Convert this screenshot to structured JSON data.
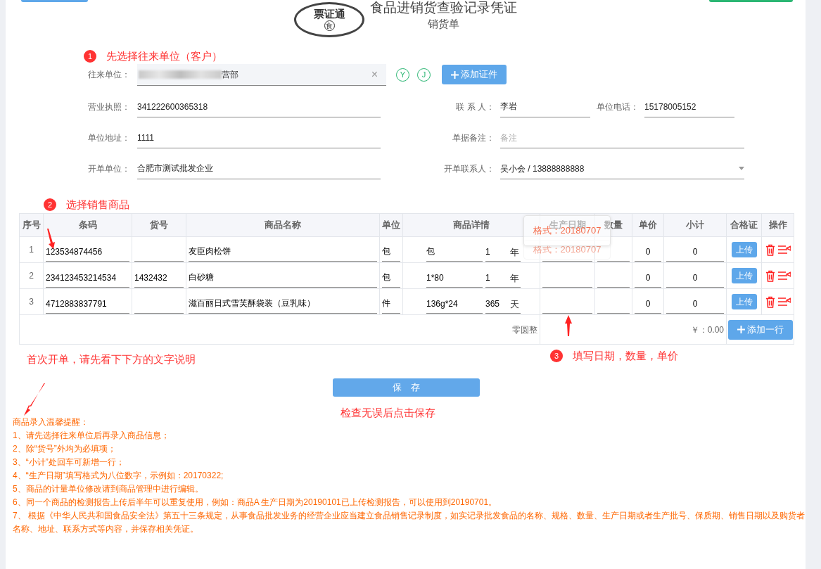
{
  "header": {
    "logo_text": "票证通",
    "logo_badge": "食",
    "title": "食品进销货查验记录凭证",
    "subtitle": "销货单"
  },
  "steps": [
    {
      "number": "1",
      "text": "先选择往来单位（客户）"
    },
    {
      "number": "2",
      "text": "选择销售商品"
    },
    {
      "number": "3",
      "text": "填写日期，数量，单价"
    }
  ],
  "partner": {
    "label": "往来单位：",
    "value": "营部",
    "blurred": true,
    "clear": "×",
    "quick_tags": [
      "Y",
      "J"
    ],
    "add_button": "添加证件"
  },
  "field_rows": [
    {
      "left": {
        "label": "营业执照：",
        "value": "341222600365318",
        "kind": "text"
      },
      "right": [
        {
          "label": "联 系 人：",
          "value": "李岩",
          "kind": "text"
        },
        {
          "label": "单位电话：",
          "value": "15178005152",
          "kind": "text"
        }
      ]
    },
    {
      "left": {
        "label": "单位地址：",
        "value": "1111",
        "kind": "text"
      },
      "right": [
        {
          "label": "单据备注：",
          "placeholder": "备注",
          "kind": "text"
        }
      ]
    },
    {
      "left": {
        "label": "开单单位：",
        "value": "合肥市测试批发企业",
        "kind": "text"
      },
      "right": [
        {
          "label": "开单联系人：",
          "value": "吴小会  /  13888888888",
          "kind": "select"
        }
      ]
    }
  ],
  "table": {
    "columns": [
      "序号",
      "条码",
      "货号",
      "商品名称",
      "单位",
      "商品详情",
      "生产日期",
      "数量",
      "单价",
      "小计",
      "合格证",
      "操作"
    ],
    "rows": [
      {
        "index": "1",
        "barcode": "123534874456",
        "item_no": "",
        "name": "友臣肉松饼",
        "unit": "包",
        "spec": "包",
        "shelf_life": "1",
        "shelf_unit": "年",
        "production_date": "",
        "quantity": "",
        "price": "0",
        "subtotal": "0",
        "upload": "上传"
      },
      {
        "index": "2",
        "barcode": "234123453214534",
        "item_no": "1432432",
        "name": "白砂糖",
        "unit": "包",
        "spec": "1*80",
        "shelf_life": "1",
        "shelf_unit": "年",
        "production_date": "",
        "quantity": "",
        "price": "0",
        "subtotal": "0",
        "upload": "上传"
      },
      {
        "index": "3",
        "barcode": "4712883837791",
        "item_no": "",
        "name": "滋百丽日式雪芙酥袋装（豆乳味）",
        "unit": "件",
        "spec": "136g*24",
        "shelf_life": "365",
        "shelf_unit": "天",
        "production_date": "",
        "quantity": "",
        "price": "0",
        "subtotal": "0",
        "upload": "上传"
      }
    ],
    "footer": {
      "rounding": "零圆整",
      "total": "￥：0.00",
      "add_row": "添加一行"
    }
  },
  "tooltips": [
    {
      "text": "格式：20180707",
      "faded": false
    },
    {
      "text": "格式：20180707",
      "faded": true
    }
  ],
  "first_time_hint": "首次开单，请先看下下方的文字说明",
  "save_button": "保　存",
  "save_hint": "检查无误后点击保存",
  "notes": {
    "title": "商品录入温馨提醒：",
    "items": [
      "1、请先选择往来单位后再录入商品信息；",
      "2、除“货号”外均为必填项；",
      "3、“小计”处回车可新增一行；",
      "4、“生产日期”填写格式为八位数字，示例如：20170322;",
      "5、商品的计量单位修改请到商品管理中进行编辑。",
      "6、同一个商品的检测报告上传后半年可以重复使用，例如：商品A 生产日期为20190101已上传检测报告，可以使用到20190701。",
      "7、 根据《中华人民共和国食品安全法》第五十三条规定，从事食品批发业务的经营企业应当建立食品销售记录制度，如实记录批发食品的名称、规格、数量、生产日期或者生产批号、保质期、销售日期以及购货者名称、地址、联系方式等内容，并保存相关凭证。"
    ]
  }
}
